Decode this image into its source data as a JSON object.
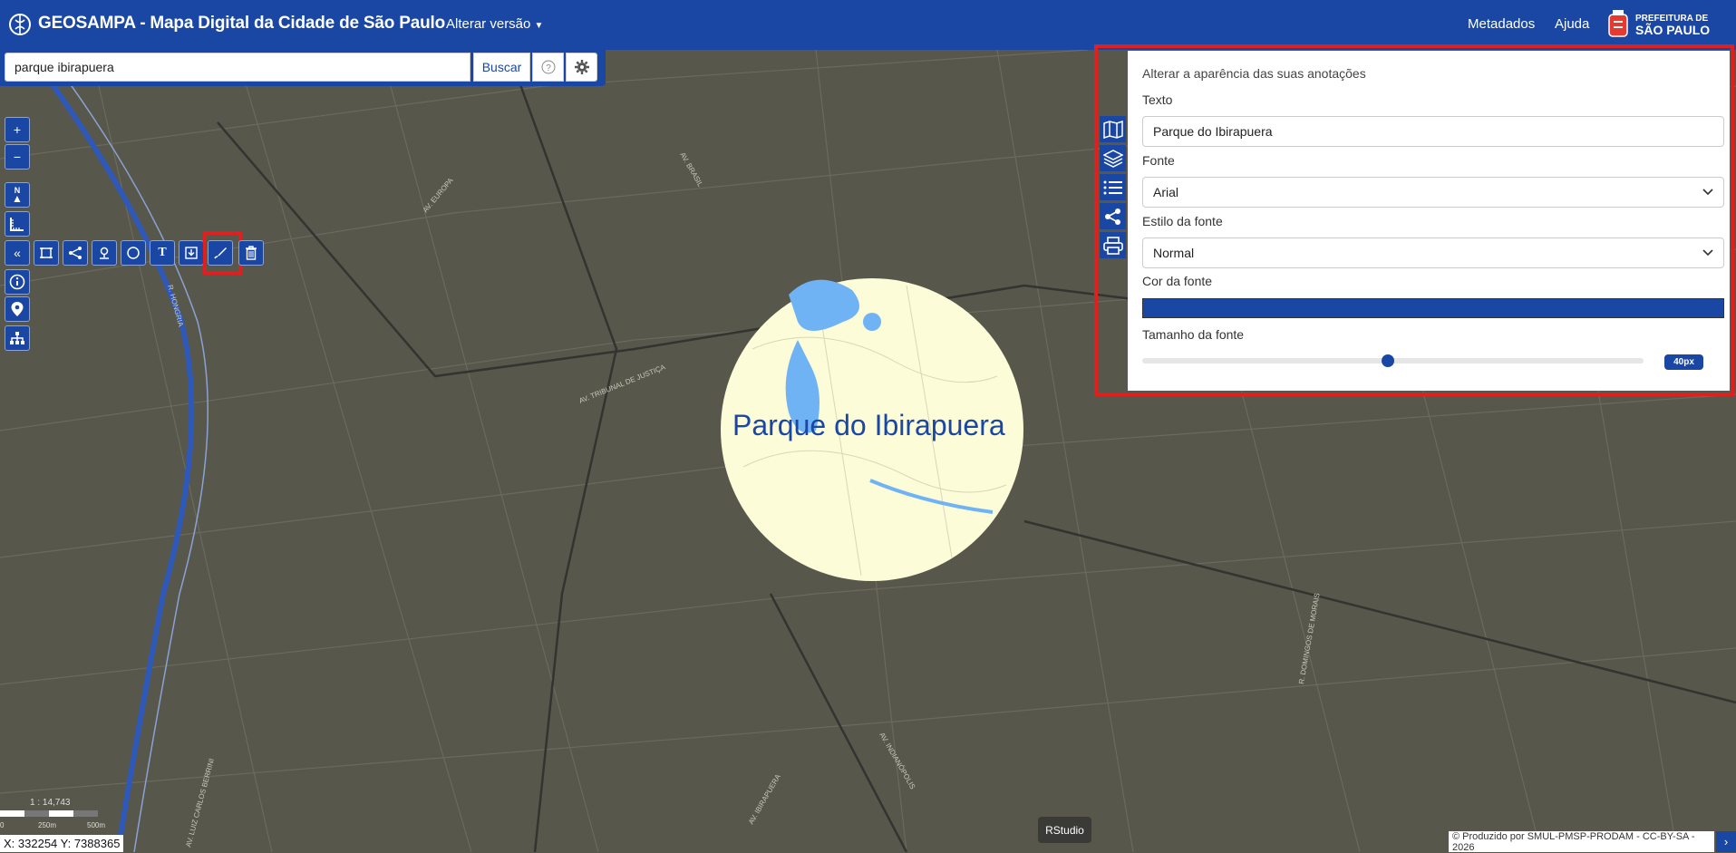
{
  "header": {
    "title": "GEOSAMPA - Mapa Digital da Cidade de São Paulo",
    "version_menu": "Alterar versão",
    "nav": {
      "metadata": "Metadados",
      "help": "Ajuda"
    },
    "city_logo": {
      "line1": "PREFEITURA DE",
      "line2": "SÃO PAULO"
    }
  },
  "search": {
    "value": "parque ibirapuera",
    "button": "Buscar",
    "help_icon": "question-circle-icon",
    "settings_icon": "gear-icon"
  },
  "map_controls": {
    "zoom_in": "+",
    "zoom_out": "−",
    "north": "N"
  },
  "draw_toolbar": {
    "tools": [
      "collapse",
      "rectangle",
      "polyline",
      "point",
      "circle",
      "text",
      "save",
      "edit-style",
      "delete"
    ],
    "active_tool": "edit-style"
  },
  "annotation_panel": {
    "heading": "Alterar a aparência das suas anotações",
    "text_label": "Texto",
    "text_value": "Parque do Ibirapuera",
    "font_label": "Fonte",
    "font_value": "Arial",
    "style_label": "Estilo da fonte",
    "style_value": "Normal",
    "color_label": "Cor da fonte",
    "color_value": "#1a47a3",
    "size_label": "Tamanho da fonte",
    "size_value": "40px",
    "size_fraction": 0.49
  },
  "map": {
    "annotation_text": "Parque do Ibirapuera",
    "street_labels": [
      "AV. BRASIL",
      "AV. EUROPA",
      "R. HONGRIA",
      "AV. TRIBUNAL DE JUSTIÇA",
      "AV. INDIANÓPOLIS",
      "AV. IBIRAPUERA",
      "R. DOMINGOS DE MORAIS",
      "AV. LUIZ CARLOS BERRINI"
    ],
    "scale": "1 : 14,743",
    "scale_ticks": [
      "0",
      "250m",
      "500m"
    ]
  },
  "status": {
    "coordinates": "X: 332254 Y: 7388365",
    "rstudio": "RStudio",
    "attribution": "© Produzido por SMUL-PMSP-PRODAM - CC-BY-SA - 2026",
    "attribution_toggle": "›"
  },
  "colors": {
    "brand": "#1a47a3",
    "highlight": "#e02020",
    "map_bg": "#58574c",
    "park": "#fdfcd9",
    "water": "#6fb3f5"
  }
}
